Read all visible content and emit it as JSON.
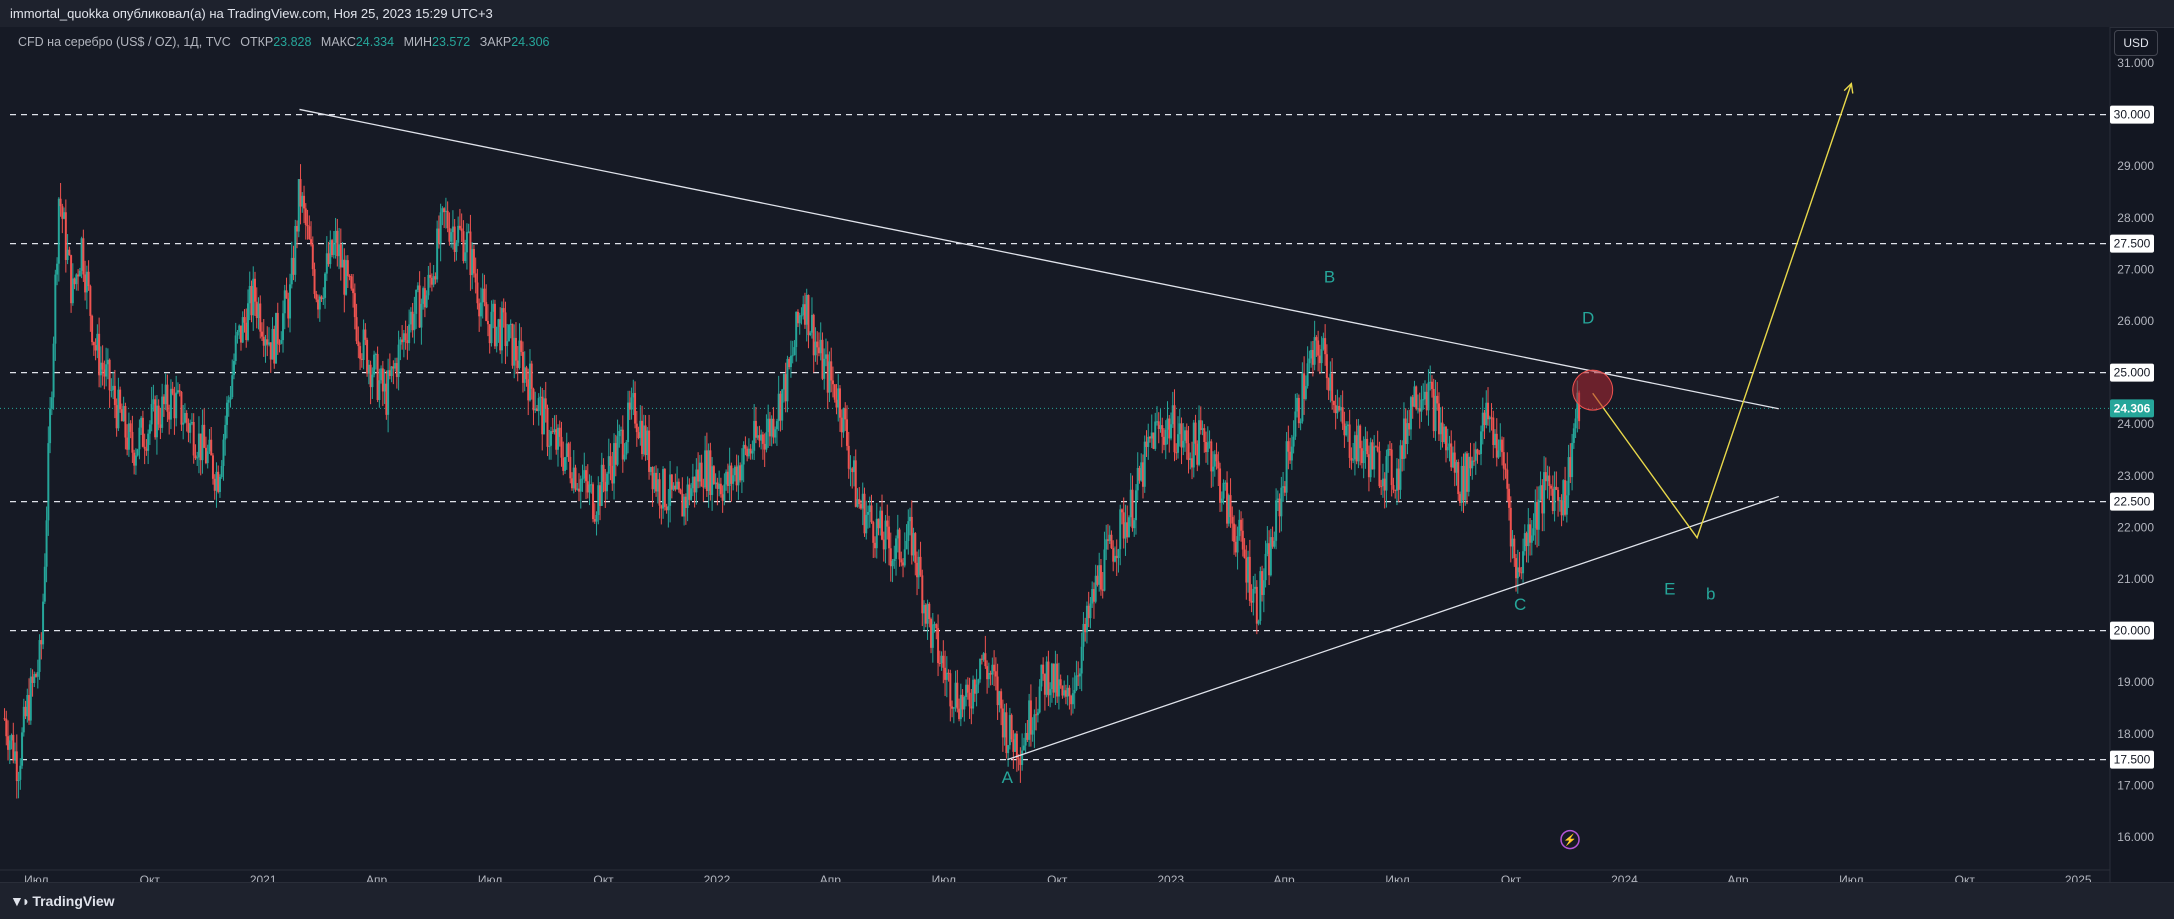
{
  "header": {
    "publish_line": "immortal_quokka опубликовал(а) на TradingView.com, Ноя 25, 2023 15:29 UTC+3"
  },
  "legend": {
    "symbol": "CFD на серебро (US$ / OZ), 1Д, TVC",
    "open_label": "ОТКР",
    "open": "23.828",
    "high_label": "МАКС",
    "high": "24.334",
    "low_label": "МИН",
    "low": "23.572",
    "close_label": "ЗАКР",
    "close": "24.306"
  },
  "currency_button": "USD",
  "footer": {
    "brand": "TradingView"
  },
  "colors": {
    "up": "#26a69a",
    "down": "#ef5350",
    "background": "#161a25",
    "projection": "#e8d84a"
  },
  "chart_data": {
    "type": "candlestick",
    "symbol": "CFD на серебро (US$ / OZ), 1Д, TVC",
    "ylim": [
      15.5,
      31.5
    ],
    "y_ticks": [
      "16.000",
      "17.000",
      "18.000",
      "19.000",
      "20.000",
      "21.000",
      "22.000",
      "23.000",
      "24.000",
      "25.000",
      "26.000",
      "27.000",
      "28.000",
      "29.000",
      "30.000",
      "31.000"
    ],
    "x_ticks": [
      {
        "label": "Июл",
        "t": 2020.5
      },
      {
        "label": "Окт",
        "t": 2020.75
      },
      {
        "label": "2021",
        "t": 2021.0
      },
      {
        "label": "Апр",
        "t": 2021.25
      },
      {
        "label": "Июл",
        "t": 2021.5
      },
      {
        "label": "Окт",
        "t": 2021.75
      },
      {
        "label": "2022",
        "t": 2022.0
      },
      {
        "label": "Апр",
        "t": 2022.25
      },
      {
        "label": "Июл",
        "t": 2022.5
      },
      {
        "label": "Окт",
        "t": 2022.75
      },
      {
        "label": "2023",
        "t": 2023.0
      },
      {
        "label": "Апр",
        "t": 2023.25
      },
      {
        "label": "Июл",
        "t": 2023.5
      },
      {
        "label": "Окт",
        "t": 2023.75
      },
      {
        "label": "2024",
        "t": 2024.0
      },
      {
        "label": "Апр",
        "t": 2024.25
      },
      {
        "label": "Июл",
        "t": 2024.5
      },
      {
        "label": "Окт",
        "t": 2024.75
      },
      {
        "label": "2025",
        "t": 2025.0
      }
    ],
    "price_path": [
      [
        2020.43,
        18.3
      ],
      [
        2020.46,
        17.4
      ],
      [
        2020.48,
        18.5
      ],
      [
        2020.51,
        19.5
      ],
      [
        2020.53,
        24.0
      ],
      [
        2020.55,
        28.5
      ],
      [
        2020.58,
        26.5
      ],
      [
        2020.6,
        27.5
      ],
      [
        2020.63,
        25.5
      ],
      [
        2020.67,
        24.5
      ],
      [
        2020.71,
        23.5
      ],
      [
        2020.75,
        24.0
      ],
      [
        2020.8,
        24.5
      ],
      [
        2020.85,
        23.8
      ],
      [
        2020.9,
        23.0
      ],
      [
        2020.94,
        25.5
      ],
      [
        2020.98,
        26.5
      ],
      [
        2021.02,
        25.5
      ],
      [
        2021.06,
        26.5
      ],
      [
        2021.08,
        28.5
      ],
      [
        2021.12,
        26.5
      ],
      [
        2021.16,
        27.5
      ],
      [
        2021.22,
        25.5
      ],
      [
        2021.27,
        24.5
      ],
      [
        2021.32,
        26.0
      ],
      [
        2021.36,
        26.5
      ],
      [
        2021.4,
        28.0
      ],
      [
        2021.45,
        27.5
      ],
      [
        2021.49,
        26.0
      ],
      [
        2021.53,
        25.8
      ],
      [
        2021.58,
        25.0
      ],
      [
        2021.63,
        23.8
      ],
      [
        2021.68,
        23.2
      ],
      [
        2021.73,
        22.5
      ],
      [
        2021.78,
        23.5
      ],
      [
        2021.82,
        24.3
      ],
      [
        2021.87,
        22.8
      ],
      [
        2021.92,
        22.4
      ],
      [
        2021.97,
        23.2
      ],
      [
        2022.02,
        22.8
      ],
      [
        2022.07,
        23.5
      ],
      [
        2022.12,
        24.0
      ],
      [
        2022.16,
        25.0
      ],
      [
        2022.19,
        26.5
      ],
      [
        2022.23,
        25.2
      ],
      [
        2022.27,
        24.5
      ],
      [
        2022.31,
        22.5
      ],
      [
        2022.35,
        22.0
      ],
      [
        2022.39,
        21.5
      ],
      [
        2022.43,
        21.8
      ],
      [
        2022.47,
        20.0
      ],
      [
        2022.51,
        19.0
      ],
      [
        2022.55,
        18.5
      ],
      [
        2022.58,
        19.5
      ],
      [
        2022.61,
        19.0
      ],
      [
        2022.64,
        18.0
      ],
      [
        2022.67,
        17.8
      ],
      [
        2022.7,
        18.6
      ],
      [
        2022.73,
        19.2
      ],
      [
        2022.77,
        18.5
      ],
      [
        2022.8,
        19.5
      ],
      [
        2022.84,
        21.0
      ],
      [
        2022.88,
        21.8
      ],
      [
        2022.92,
        22.5
      ],
      [
        2022.96,
        23.8
      ],
      [
        2023.0,
        24.0
      ],
      [
        2023.04,
        23.5
      ],
      [
        2023.08,
        23.8
      ],
      [
        2023.12,
        22.5
      ],
      [
        2023.16,
        21.5
      ],
      [
        2023.19,
        20.5
      ],
      [
        2023.22,
        21.5
      ],
      [
        2023.26,
        23.5
      ],
      [
        2023.3,
        25.0
      ],
      [
        2023.33,
        25.5
      ],
      [
        2023.35,
        25.0
      ],
      [
        2023.38,
        23.8
      ],
      [
        2023.42,
        23.5
      ],
      [
        2023.46,
        23.2
      ],
      [
        2023.5,
        23.0
      ],
      [
        2023.53,
        24.5
      ],
      [
        2023.56,
        24.8
      ],
      [
        2023.6,
        23.8
      ],
      [
        2023.64,
        22.8
      ],
      [
        2023.67,
        23.5
      ],
      [
        2023.7,
        24.2
      ],
      [
        2023.74,
        23.0
      ],
      [
        2023.76,
        21.0
      ],
      [
        2023.79,
        22.0
      ],
      [
        2023.83,
        22.8
      ],
      [
        2023.87,
        22.6
      ],
      [
        2023.89,
        24.0
      ],
      [
        2023.9,
        24.3
      ]
    ],
    "horizontal_levels": [
      "17.500",
      "20.000",
      "22.500",
      "25.000",
      "27.500",
      "30.000"
    ],
    "current_price": "24.306",
    "wave_labels": [
      "A",
      "B",
      "C",
      "D",
      "E",
      "b"
    ],
    "trendlines": {
      "upper": [
        [
          2021.08,
          30.1
        ],
        [
          2024.34,
          24.3
        ]
      ],
      "lower": [
        [
          2022.64,
          17.5
        ],
        [
          2024.34,
          22.6
        ]
      ]
    },
    "projection": [
      [
        2023.93,
        24.6
      ],
      [
        2024.16,
        21.8
      ],
      [
        2024.5,
        30.6
      ]
    ],
    "xlim": [
      2020.42,
      2025.07
    ]
  }
}
